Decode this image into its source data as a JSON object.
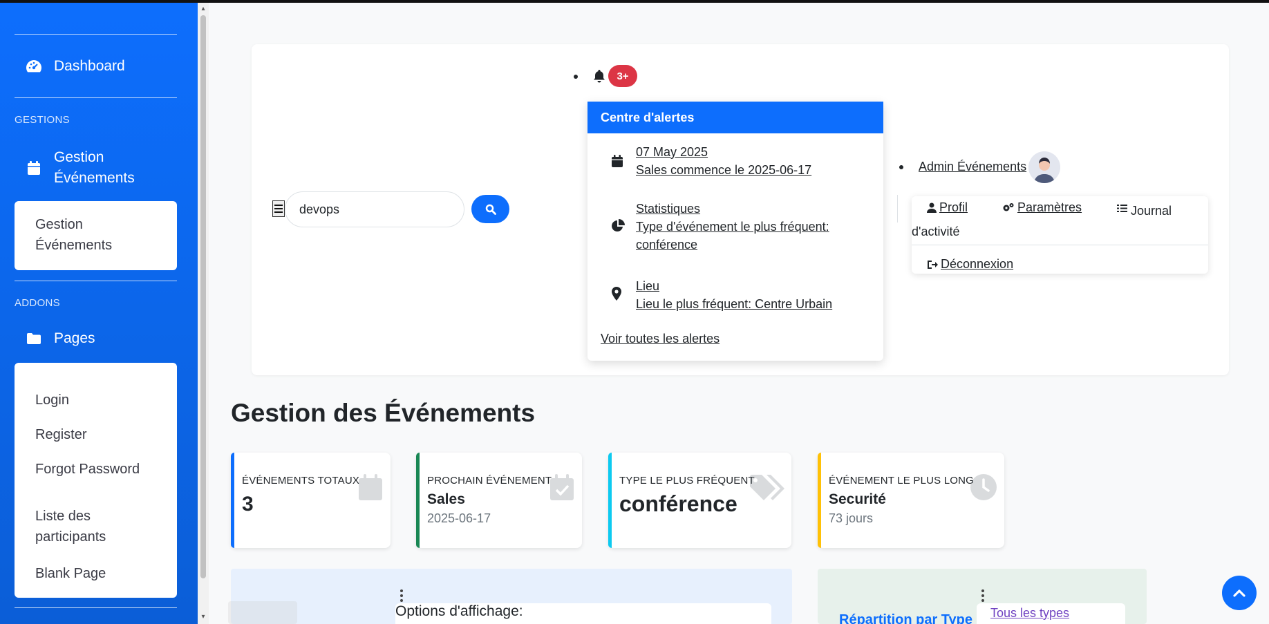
{
  "sidebar": {
    "dashboard_label": "Dashboard",
    "heading_gestions": "GESTIONS",
    "gestion_label": "Gestion Événements",
    "gestion_sub": "Gestion Événements",
    "heading_addons": "ADDONS",
    "pages_label": "Pages",
    "pages_items": [
      "Login",
      "Register",
      "Forgot Password",
      "Liste des participants",
      "Blank Page"
    ]
  },
  "search": {
    "value": "devops"
  },
  "alerts": {
    "count": "3+",
    "title": "Centre d'alertes",
    "items": [
      {
        "icon": "calendar-icon",
        "line1": "07 May 2025",
        "line2": "Sales commence le 2025-06-17"
      },
      {
        "icon": "chart-pie-icon",
        "line1": "Statistiques",
        "line2": "Type d'événement le plus fréquent: conférence"
      },
      {
        "icon": "map-marker-icon",
        "line1": "Lieu",
        "line2": "Lieu le plus fréquent: Centre Urbain"
      }
    ],
    "footer": "Voir toutes les alertes"
  },
  "user": {
    "name": "Admin Événements",
    "menu": {
      "profil": "Profil",
      "parametres": "Paramètres",
      "journal": "Journal d'activité",
      "deconnexion": "Déconnexion"
    }
  },
  "main": {
    "title": "Gestion des Événements",
    "cards": [
      {
        "label": "ÉVÉNEMENTS TOTAUX",
        "value": "3",
        "sub": "",
        "color": "#0d6efd",
        "icon": "calendar-icon"
      },
      {
        "label": "PROCHAIN ÉVÉNEMENT",
        "value": "Sales",
        "sub": "2025-06-17",
        "color": "#198754",
        "icon": "calendar-check-icon"
      },
      {
        "label": "TYPE LE PLUS FRÉQUENT",
        "value": "conférence",
        "sub": "",
        "color": "#0dcaf0",
        "icon": "tags-icon"
      },
      {
        "label": "ÉVÉNEMENT LE PLUS LONG",
        "value": "Securité",
        "sub": "73 jours",
        "color": "#ffc107",
        "icon": "clock-icon"
      }
    ],
    "options_label": "Options d'affichage:",
    "repartition_label": "Répartition par Type",
    "types_option": "Tous les types"
  }
}
